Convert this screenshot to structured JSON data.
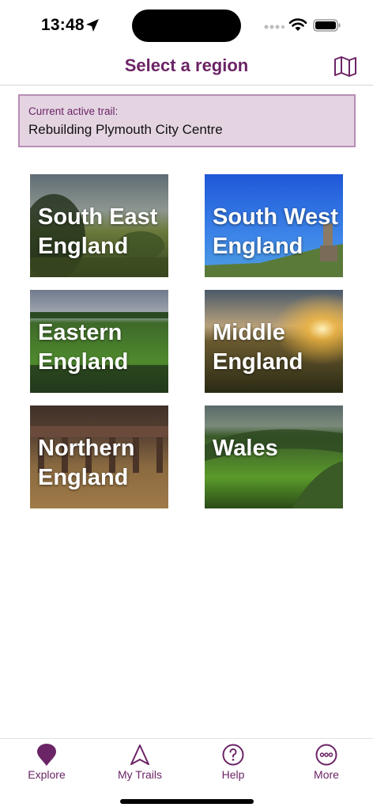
{
  "status_bar": {
    "time": "13:48"
  },
  "header": {
    "title": "Select a region",
    "map_icon": "map-icon"
  },
  "active_trail": {
    "label": "Current active trail:",
    "name": "Rebuilding Plymouth City Centre"
  },
  "regions": [
    {
      "label": "South East\nEngland"
    },
    {
      "label": "South West\nEngland"
    },
    {
      "label": "Eastern\nEngland"
    },
    {
      "label": "Middle\nEngland"
    },
    {
      "label": "Northern\nEngland"
    },
    {
      "label": "Wales"
    }
  ],
  "tabs": [
    {
      "label": "Explore",
      "icon": "map-pin-icon"
    },
    {
      "label": "My Trails",
      "icon": "navigation-arrow-icon"
    },
    {
      "label": "Help",
      "icon": "question-circle-icon"
    },
    {
      "label": "More",
      "icon": "more-dots-icon"
    }
  ],
  "colors": {
    "brand": "#6b2466",
    "banner_bg": "#e4d4e2",
    "banner_border": "#b98db5"
  }
}
